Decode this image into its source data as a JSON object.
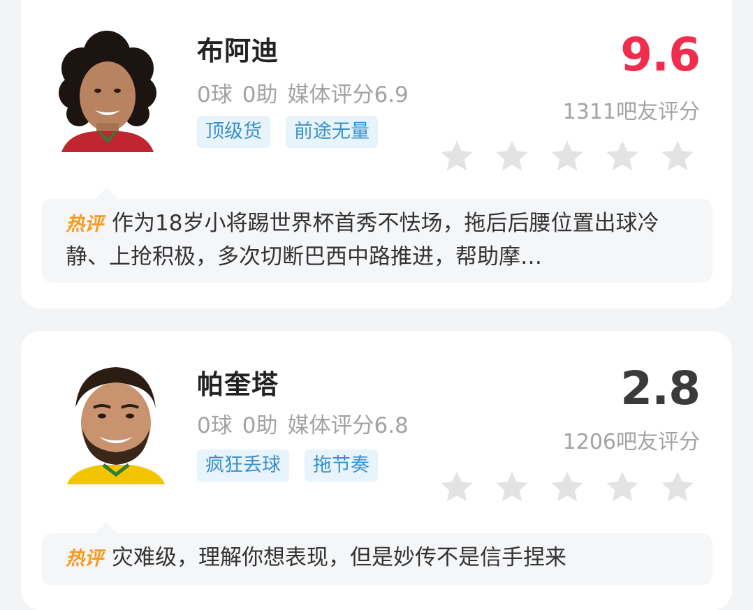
{
  "players": [
    {
      "name": "布阿迪",
      "goals": "0球",
      "assists": "0助",
      "media_rating": "媒体评分6.9",
      "tags": [
        "顶级货",
        "前途无量"
      ],
      "score": "9.6",
      "fan_count": "1311吧友评分",
      "stars_filled": 0,
      "comment_badge": "热评",
      "comment_text": "作为18岁小将踢世界杯首秀不怯场，拖后后腰位置出球冷静、上抢积极，多次切断巴西中路推进，帮助摩…",
      "colors": {
        "score": "#f02d4c",
        "jersey": "#c0262f"
      }
    },
    {
      "name": "帕奎塔",
      "goals": "0球",
      "assists": "0助",
      "media_rating": "媒体评分6.8",
      "tags": [
        "疯狂丢球",
        "拖节奏"
      ],
      "score": "2.8",
      "fan_count": "1206吧友评分",
      "stars_filled": 0,
      "comment_badge": "热评",
      "comment_text": "灾难级，理解你想表现，但是妙传不是信手捏来",
      "colors": {
        "score": "#3a3a3a",
        "jersey": "#f2c500"
      }
    }
  ],
  "colors": {
    "background": "#f3f4f6",
    "star_empty": "#e3e3e3",
    "tag_bg": "#e8f4fb",
    "tag_text": "#3b8fc9",
    "badge": "#f59a1d"
  }
}
